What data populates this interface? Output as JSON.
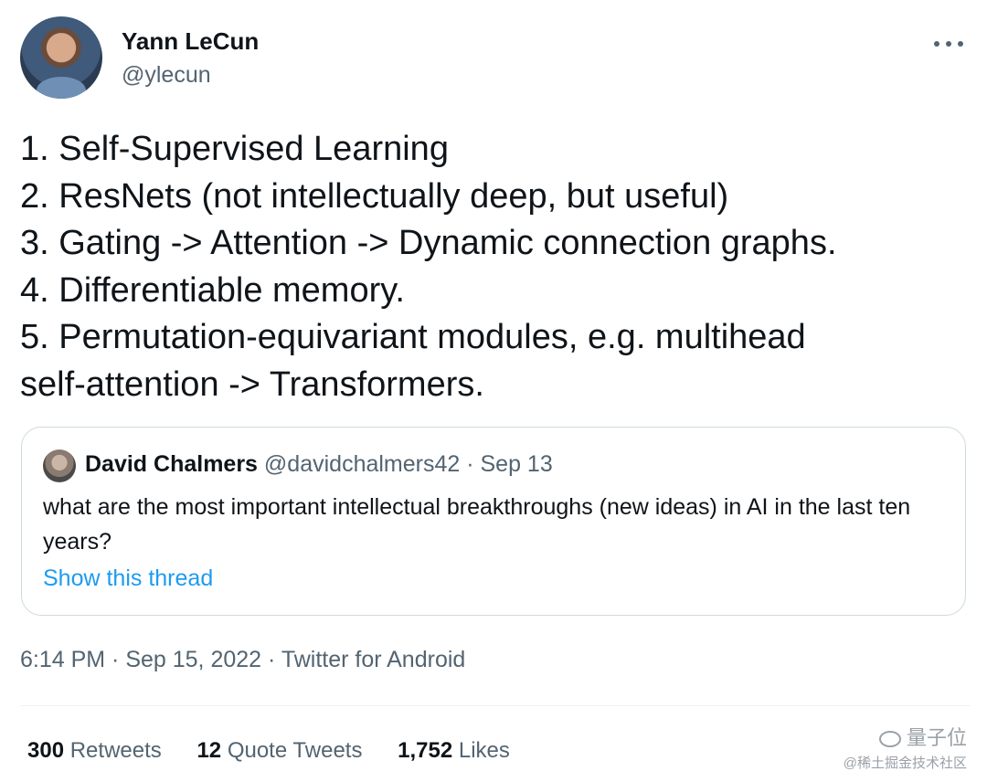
{
  "author": {
    "name": "Yann LeCun",
    "handle": "@ylecun"
  },
  "tweet": {
    "lines": [
      "1. Self-Supervised Learning",
      "2. ResNets (not intellectually deep, but useful)",
      "3. Gating -> Attention -> Dynamic connection graphs.",
      "4. Differentiable memory.",
      "5. Permutation-equivariant modules, e.g. multihead",
      "self-attention -> Transformers."
    ]
  },
  "quote": {
    "name": "David Chalmers",
    "meta": "@davidchalmers42 · Sep 13",
    "text": "what are the most important intellectual breakthroughs (new ideas) in AI in the last ten years?",
    "link": "Show this thread"
  },
  "timestamp": "6:14 PM · Sep 15, 2022 · Twitter for Android",
  "stats": {
    "retweets": {
      "count": "300",
      "label": "Retweets"
    },
    "quotes": {
      "count": "12",
      "label": "Quote Tweets"
    },
    "likes": {
      "count": "1,752",
      "label": "Likes"
    }
  },
  "watermark": {
    "top": "量子位",
    "bottom": "@稀土掘金技术社区"
  },
  "icons": [
    "more-icon",
    "wechat-icon"
  ],
  "colors": {
    "text": "#0f1419",
    "secondary": "#536471",
    "link": "#1d9bf0",
    "border": "#cfd9de"
  }
}
